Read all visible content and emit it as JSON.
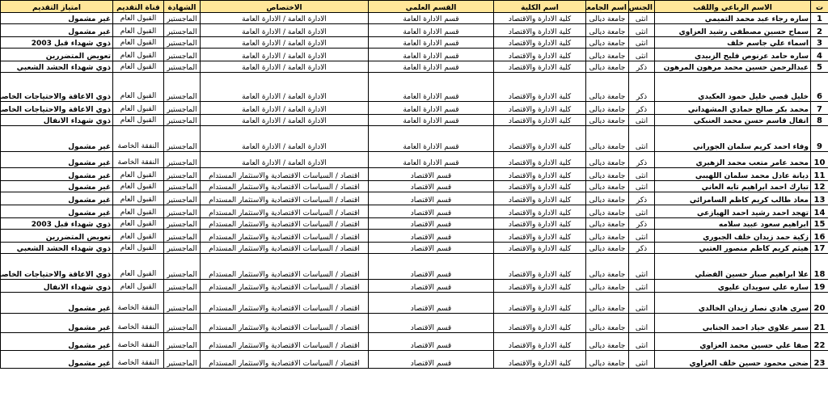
{
  "headers": [
    "ت",
    "الاسم الرباعي واللقب",
    "الجنس",
    "اسم الجامعة",
    "اسم الكلية",
    "القسم العلمي",
    "الاختصاص",
    "الشهادة",
    "قناة التقديم",
    "امتياز التقديم"
  ],
  "rows": [
    {
      "n": "1",
      "name": "ساره رجاء عبد محمد التميمي",
      "gender": "انثى",
      "univ": "جامعة ديالى",
      "college": "كلية الادارة والاقتصاد",
      "dept": "قسم الادارة العامة",
      "spec": "الادارة العامة / الادارة العامة",
      "degree": "الماجستير",
      "channel": "القبول العام",
      "priv": "غير مشمول"
    },
    {
      "n": "2",
      "name": "سماح حسين مصطفى رشيد العزاوي",
      "gender": "انثى",
      "univ": "جامعة ديالى",
      "college": "كلية الادارة والاقتصاد",
      "dept": "قسم الادارة العامة",
      "spec": "الادارة العامة / الادارة العامة",
      "degree": "الماجستير",
      "channel": "القبول العام",
      "priv": "غير مشمول"
    },
    {
      "n": "3",
      "name": "اسماء علي جاسم خلف",
      "gender": "انثى",
      "univ": "جامعة ديالى",
      "college": "كلية الادارة والاقتصاد",
      "dept": "قسم الادارة العامة",
      "spec": "الادارة العامة / الادارة العامة",
      "degree": "الماجستير",
      "channel": "القبول العام",
      "priv": "ذوي شهداء قبل 2003"
    },
    {
      "n": "4",
      "name": "ساره حامد عرنوص فليح الزبيدي",
      "gender": "انثى",
      "univ": "جامعة ديالى",
      "college": "كلية الادارة والاقتصاد",
      "dept": "قسم الادارة العامة",
      "spec": "الادارة العامة / الادارة العامة",
      "degree": "الماجستير",
      "channel": "القبول العام",
      "priv": "تعويض المتضررين"
    },
    {
      "n": "5",
      "name": "عبدالرحمن حسين محمد مرهون المرهون",
      "gender": "ذكر",
      "univ": "جامعة ديالى",
      "college": "كلية الادارة والاقتصاد",
      "dept": "قسم الادارة العامة",
      "spec": "الادارة العامة / الادارة العامة",
      "degree": "الماجستير",
      "channel": "القبول العام",
      "priv": "ذوي شهداء الحشد الشعبي"
    },
    {
      "n": "6",
      "name": "خليل قصي خليل حمود العكيدي",
      "gender": "ذكر",
      "univ": "جامعة ديالى",
      "college": "كلية الادارة والاقتصاد",
      "dept": "قسم الادارة العامة",
      "spec": "الادارة العامة / الادارة العامة",
      "degree": "الماجستير",
      "channel": "القبول العام",
      "priv": "ذوي الاعاقة والاحتياجات الخاصة"
    },
    {
      "n": "7",
      "name": "محمد بكر صالح حمادي المشهداني",
      "gender": "ذكر",
      "univ": "جامعة ديالى",
      "college": "كلية الادارة والاقتصاد",
      "dept": "قسم الادارة العامة",
      "spec": "الادارة العامة / الادارة العامة",
      "degree": "الماجستير",
      "channel": "القبول العام",
      "priv": "ذوي الاعاقة والاحتياجات الخاصة"
    },
    {
      "n": "8",
      "name": "انفال قاسم حسن محمد العنبكي",
      "gender": "انثى",
      "univ": "جامعة ديالى",
      "college": "كلية الادارة والاقتصاد",
      "dept": "قسم الادارة العامة",
      "spec": "الادارة العامة / الادارة العامة",
      "degree": "الماجستير",
      "channel": "القبول العام",
      "priv": "ذوي شهداء الانفال"
    },
    {
      "n": "9",
      "name": "وفاء احمد كريم سلمان الجوراني",
      "gender": "انثى",
      "univ": "جامعة ديالى",
      "college": "كلية الادارة والاقتصاد",
      "dept": "قسم الادارة العامة",
      "spec": "الادارة العامة / الادارة العامة",
      "degree": "الماجستير",
      "channel": "النفقة الخاصة",
      "priv": "غير مشمول"
    },
    {
      "n": "10",
      "name": "محمد عامر متعب محمد الزهيري",
      "gender": "ذكر",
      "univ": "جامعة ديالى",
      "college": "كلية الادارة والاقتصاد",
      "dept": "قسم الادارة العامة",
      "spec": "الادارة العامة / الادارة العامة",
      "degree": "الماجستير",
      "channel": "النفقة الخاصة",
      "priv": "غير مشمول"
    },
    {
      "n": "11",
      "name": "ديانة عادل محمد سلمان اللهيبي",
      "gender": "انثى",
      "univ": "جامعة ديالى",
      "college": "كلية الادارة والاقتصاد",
      "dept": "قسم الاقتصاد",
      "spec": "اقتصاد / السياسات الاقتصادية والاستثمار المستدام",
      "degree": "الماجستير",
      "channel": "القبول العام",
      "priv": "غير مشمول"
    },
    {
      "n": "12",
      "name": "تبارك احمد ابراهيم تايه العاني",
      "gender": "انثى",
      "univ": "جامعة ديالى",
      "college": "كلية الادارة والاقتصاد",
      "dept": "قسم الاقتصاد",
      "spec": "اقتصاد / السياسات الاقتصادية والاستثمار المستدام",
      "degree": "الماجستير",
      "channel": "القبول العام",
      "priv": "غير مشمول"
    },
    {
      "n": "13",
      "name": "معاذ طالب كريم كاظم السامرائي",
      "gender": "ذكر",
      "univ": "جامعة ديالى",
      "college": "كلية الادارة والاقتصاد",
      "dept": "قسم الاقتصاد",
      "spec": "اقتصاد / السياسات الاقتصادية والاستثمار المستدام",
      "degree": "الماجستير",
      "channel": "القبول العام",
      "priv": "غير مشمول"
    },
    {
      "n": "14",
      "name": "تهجد احمد رشيد احمد الهيازعي",
      "gender": "انثى",
      "univ": "جامعة ديالى",
      "college": "كلية الادارة والاقتصاد",
      "dept": "قسم الاقتصاد",
      "spec": "اقتصاد / السياسات الاقتصادية والاستثمار المستدام",
      "degree": "الماجستير",
      "channel": "القبول العام",
      "priv": "غير مشمول"
    },
    {
      "n": "15",
      "name": "ابراهيم سعود عبيد سلامه",
      "gender": "ذكر",
      "univ": "جامعة ديالى",
      "college": "كلية الادارة والاقتصاد",
      "dept": "قسم الاقتصاد",
      "spec": "اقتصاد / السياسات الاقتصادية والاستثمار المستدام",
      "degree": "الماجستير",
      "channel": "القبول العام",
      "priv": "ذوي شهداء قبل 2003"
    },
    {
      "n": "16",
      "name": "زكية حمد زيدان خلف الجبوري",
      "gender": "انثى",
      "univ": "جامعة ديالى",
      "college": "كلية الادارة والاقتصاد",
      "dept": "قسم الاقتصاد",
      "spec": "اقتصاد / السياسات الاقتصادية والاستثمار المستدام",
      "degree": "الماجستير",
      "channel": "القبول العام",
      "priv": "تعويض المتضررين"
    },
    {
      "n": "17",
      "name": "هيثم كريم كاظم منصور العتبي",
      "gender": "ذكر",
      "univ": "جامعة ديالى",
      "college": "كلية الادارة والاقتصاد",
      "dept": "قسم الاقتصاد",
      "spec": "اقتصاد / السياسات الاقتصادية والاستثمار المستدام",
      "degree": "الماجستير",
      "channel": "القبول العام",
      "priv": "ذوي شهداء الحشد الشعبي"
    },
    {
      "n": "18",
      "name": "علا ابراهيم صبار حسين الفضلي",
      "gender": "انثى",
      "univ": "جامعة ديالى",
      "college": "كلية الادارة والاقتصاد",
      "dept": "قسم الاقتصاد",
      "spec": "اقتصاد / السياسات الاقتصادية والاستثمار المستدام",
      "degree": "الماجستير",
      "channel": "القبول العام",
      "priv": "ذوي الاعاقة والاحتياجات الخاصة"
    },
    {
      "n": "19",
      "name": "ساره علي سويدان عليوي",
      "gender": "انثى",
      "univ": "جامعة ديالى",
      "college": "كلية الادارة والاقتصاد",
      "dept": "قسم الاقتصاد",
      "spec": "اقتصاد / السياسات الاقتصادية والاستثمار المستدام",
      "degree": "الماجستير",
      "channel": "القبول العام",
      "priv": "ذوي شهداء الانفال"
    },
    {
      "n": "20",
      "name": "سرى هادي نصار زيدان الخالدي",
      "gender": "انثى",
      "univ": "جامعة ديالى",
      "college": "كلية الادارة والاقتصاد",
      "dept": "قسم الاقتصاد",
      "spec": "اقتصاد / السياسات الاقتصادية والاستثمار المستدام",
      "degree": "الماجستير",
      "channel": "النفقة الخاصة",
      "priv": "غير مشمول"
    },
    {
      "n": "21",
      "name": "سمر علاوي جياد احمد الجنابي",
      "gender": "انثى",
      "univ": "جامعة ديالى",
      "college": "كلية الادارة والاقتصاد",
      "dept": "قسم الاقتصاد",
      "spec": "اقتصاد / السياسات الاقتصادية والاستثمار المستدام",
      "degree": "الماجستير",
      "channel": "النفقة الخاصة",
      "priv": "غير مشمول"
    },
    {
      "n": "22",
      "name": "صفا علي حسين محمد العزاوي",
      "gender": "انثى",
      "univ": "جامعة ديالى",
      "college": "كلية الادارة والاقتصاد",
      "dept": "قسم الاقتصاد",
      "spec": "اقتصاد / السياسات الاقتصادية والاستثمار المستدام",
      "degree": "الماجستير",
      "channel": "النفقة الخاصة",
      "priv": "غير مشمول"
    },
    {
      "n": "23",
      "name": "ضحى محمود حسين خلف العزاوي",
      "gender": "انثى",
      "univ": "جامعة ديالى",
      "college": "كلية الادارة والاقتصاد",
      "dept": "قسم الاقتصاد",
      "spec": "اقتصاد / السياسات الاقتصادية والاستثمار المستدام",
      "degree": "الماجستير",
      "channel": "النفقة الخاصة",
      "priv": "غير مشمول"
    }
  ]
}
